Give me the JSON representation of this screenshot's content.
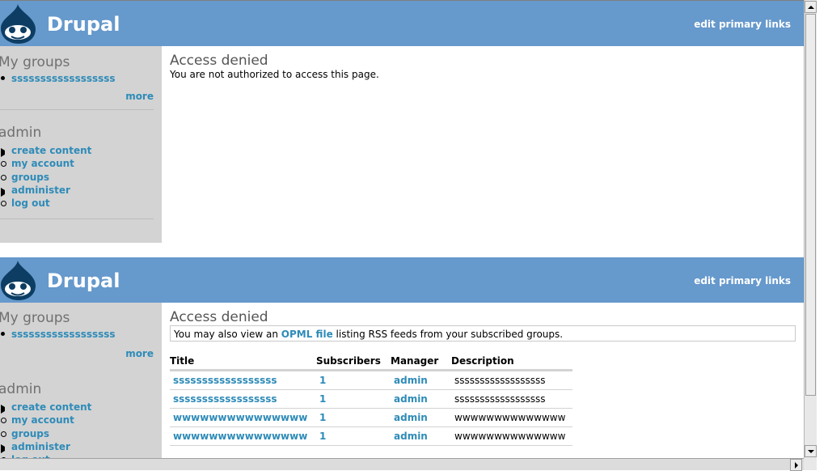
{
  "site": {
    "name": "Drupal",
    "primary_links": "edit primary links"
  },
  "sidebar": {
    "my_groups_title": "My groups",
    "my_groups": [
      "ssssssssssssssssss"
    ],
    "more": "more",
    "admin_title": "admin",
    "admin_links": [
      "create content",
      "my account",
      "groups",
      "administer",
      "log out"
    ]
  },
  "page1": {
    "title": "Access denied",
    "message": "You are not authorized to access this page."
  },
  "page2": {
    "title": "Access denied",
    "notice_prefix": "You may also view an",
    "notice_link": "OPML file",
    "notice_suffix": "listing RSS feeds from your subscribed groups.",
    "table": {
      "headers": [
        "Title",
        "Subscribers",
        "Manager",
        "Description"
      ],
      "rows": [
        [
          "ssssssssssssssssss",
          "1",
          "admin",
          "ssssssssssssssssss"
        ],
        [
          "ssssssssssssssssss",
          "1",
          "admin",
          "ssssssssssssssssss"
        ],
        [
          "wwwwwwwwwwwwwww",
          "1",
          "admin",
          "wwwwwwwwwwwwww"
        ],
        [
          "wwwwwwwwwwwwwww",
          "1",
          "admin",
          "wwwwwwwwwwwwww"
        ]
      ]
    }
  },
  "colors": {
    "header": "#6699cc",
    "sidebar": "#d3d3d3",
    "link": "#2e8bb8"
  }
}
